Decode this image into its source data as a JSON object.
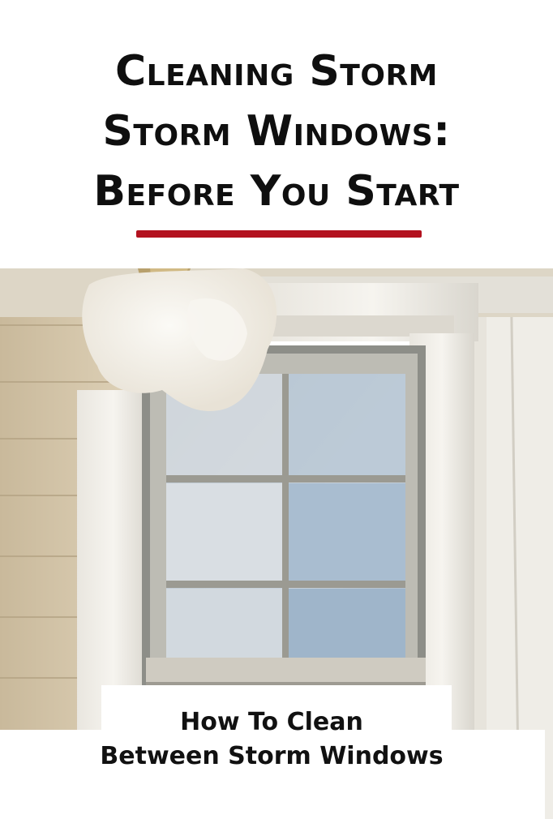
{
  "title": {
    "line1": "Cleaning Storm",
    "line2": "Storm Windows:",
    "line3": "Before You Start"
  },
  "caption": {
    "line1": "How To Clean",
    "line2": "Between Storm Windows"
  },
  "colors": {
    "accent_rule": "#b3121f",
    "title_text": "#0f0f0f"
  }
}
